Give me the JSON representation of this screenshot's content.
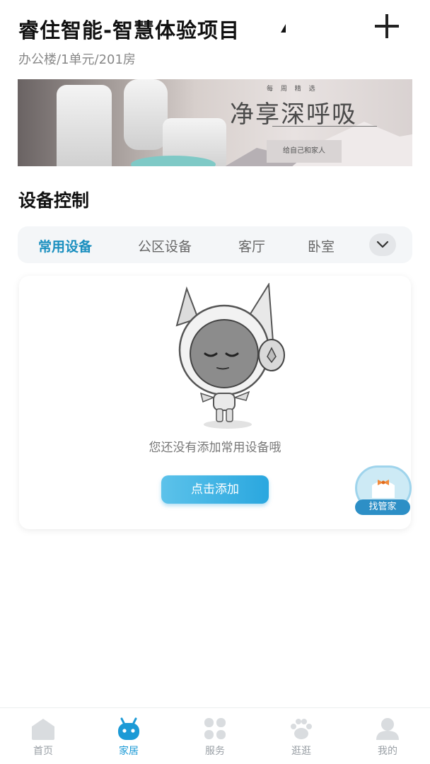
{
  "header": {
    "project_title": "睿住智能-智慧体验项目",
    "location": "办公楼/1单元/201房",
    "add_icon": "plus-icon"
  },
  "banner": {
    "tag": "每 周 精 选",
    "slogan": "净享深呼吸",
    "subtag": "给自己和家人"
  },
  "device_control": {
    "title": "设备控制",
    "tabs": [
      {
        "label": "常用设备",
        "active": true
      },
      {
        "label": "公区设备",
        "active": false
      },
      {
        "label": "客厅",
        "active": false
      },
      {
        "label": "卧室",
        "active": false
      }
    ],
    "more_icon": "chevron-down-icon"
  },
  "empty_state": {
    "message": "您还没有添加常用设备哦",
    "add_button": "点击添加"
  },
  "butler": {
    "label": "找管家"
  },
  "bottom_nav": {
    "items": [
      {
        "label": "首页",
        "icon": "home-icon",
        "active": false
      },
      {
        "label": "家居",
        "icon": "robot-icon",
        "active": true
      },
      {
        "label": "服务",
        "icon": "grid-icon",
        "active": false
      },
      {
        "label": "逛逛",
        "icon": "paw-icon",
        "active": false
      },
      {
        "label": "我的",
        "icon": "user-icon",
        "active": false
      }
    ]
  },
  "colors": {
    "accent": "#1c9ad6",
    "button_gradient_start": "#5cc2ea",
    "button_gradient_end": "#2aa7df",
    "inactive": "#9aa0a6"
  }
}
